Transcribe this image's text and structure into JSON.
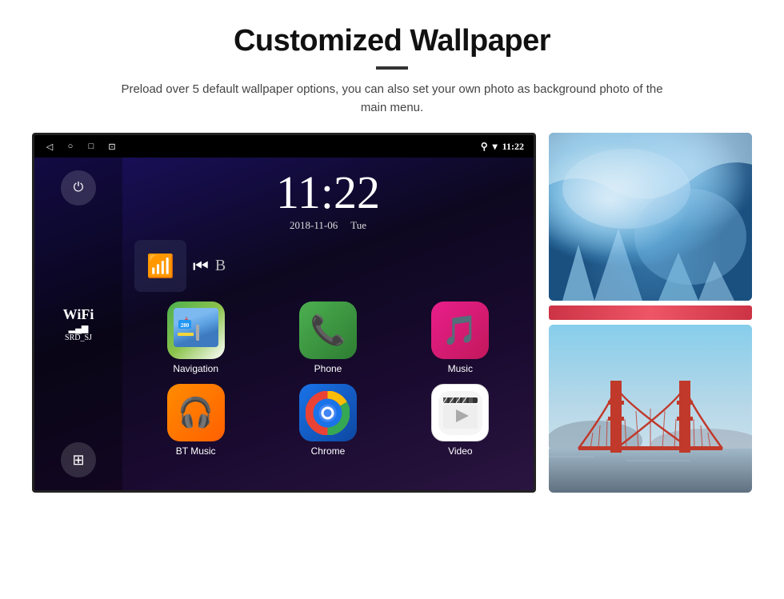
{
  "header": {
    "title": "Customized Wallpaper",
    "subtitle": "Preload over 5 default wallpaper options, you can also set your own photo as background photo of the main menu."
  },
  "android": {
    "status_bar": {
      "time": "11:22",
      "wifi_icon": "▾",
      "location_icon": "⚲"
    },
    "sidebar": {
      "power_label": "⏻",
      "wifi_ssid": "WiFi",
      "wifi_signal": "▂▄▆",
      "wifi_name": "SRD_SJ",
      "apps_icon": "⊞"
    },
    "clock": {
      "time": "11:22",
      "date": "2018-11-06",
      "day": "Tue"
    },
    "apps": [
      {
        "id": "navigation",
        "label": "Navigation",
        "icon_type": "nav"
      },
      {
        "id": "phone",
        "label": "Phone",
        "icon_type": "phone"
      },
      {
        "id": "music",
        "label": "Music",
        "icon_type": "music"
      },
      {
        "id": "bt_music",
        "label": "BT Music",
        "icon_type": "bt"
      },
      {
        "id": "chrome",
        "label": "Chrome",
        "icon_type": "chrome"
      },
      {
        "id": "video",
        "label": "Video",
        "icon_type": "video"
      }
    ]
  },
  "wallpapers": [
    {
      "id": "ice",
      "type": "ice",
      "description": "Ice blue wallpaper"
    },
    {
      "id": "bridge",
      "type": "bridge",
      "description": "Golden Gate Bridge wallpaper"
    }
  ]
}
